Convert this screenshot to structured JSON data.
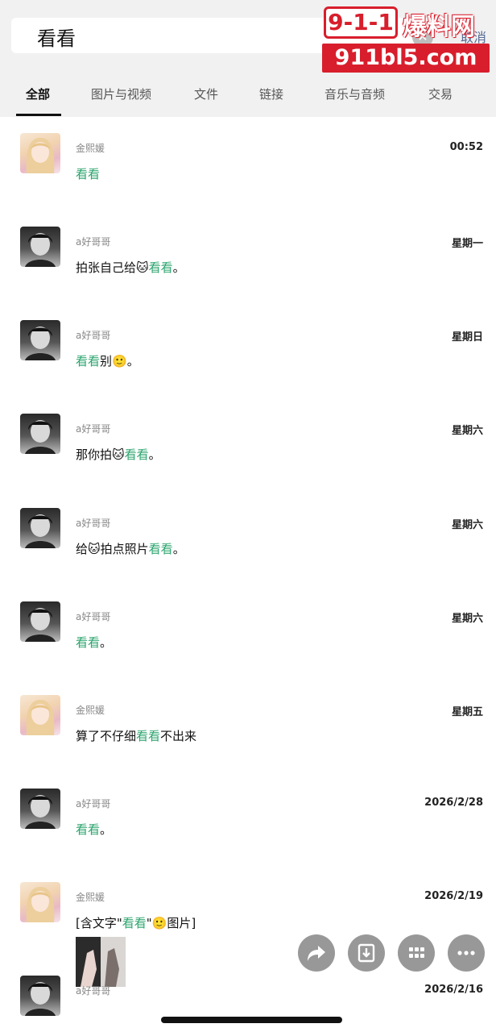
{
  "search": {
    "query": "看看",
    "cancel_label": "取消"
  },
  "tabs": [
    "全部",
    "图片与视频",
    "文件",
    "链接",
    "音乐与音频",
    "交易"
  ],
  "results": [
    {
      "sender": "金熙媛",
      "time": "00:52",
      "avatar": "girl",
      "parts": [
        {
          "t": "看看",
          "hl": true
        }
      ]
    },
    {
      "sender": "a好哥哥",
      "time": "星期一",
      "avatar": "boy",
      "parts": [
        {
          "t": "拍张自己给"
        },
        {
          "t": "🐱",
          "emoji": true
        },
        {
          "t": "看看",
          "hl": true
        },
        {
          "t": "。"
        }
      ]
    },
    {
      "sender": "a好哥哥",
      "time": "星期日",
      "avatar": "boy",
      "parts": [
        {
          "t": "看看",
          "hl": true
        },
        {
          "t": "别"
        },
        {
          "t": "🙂",
          "emoji": true
        },
        {
          "t": "。"
        }
      ]
    },
    {
      "sender": "a好哥哥",
      "time": "星期六",
      "avatar": "boy",
      "parts": [
        {
          "t": "那你拍"
        },
        {
          "t": "🐱",
          "emoji": true
        },
        {
          "t": "看看",
          "hl": true
        },
        {
          "t": "。"
        }
      ]
    },
    {
      "sender": "a好哥哥",
      "time": "星期六",
      "avatar": "boy",
      "parts": [
        {
          "t": "给"
        },
        {
          "t": "🐱",
          "emoji": true
        },
        {
          "t": "拍点照片"
        },
        {
          "t": "看看",
          "hl": true
        },
        {
          "t": "。"
        }
      ]
    },
    {
      "sender": "a好哥哥",
      "time": "星期六",
      "avatar": "boy",
      "parts": [
        {
          "t": "看看",
          "hl": true
        },
        {
          "t": "。"
        }
      ]
    },
    {
      "sender": "金熙媛",
      "time": "星期五",
      "avatar": "girl",
      "parts": [
        {
          "t": "算了不仔细"
        },
        {
          "t": "看看",
          "hl": true
        },
        {
          "t": "不出来"
        }
      ]
    },
    {
      "sender": "a好哥哥",
      "time": "2026/2/28",
      "avatar": "boy",
      "parts": [
        {
          "t": "看看",
          "hl": true
        },
        {
          "t": "。"
        }
      ]
    },
    {
      "sender": "金熙媛",
      "time": "2026/2/19",
      "avatar": "girl",
      "has_image": true,
      "parts": [
        {
          "t": "[含文字\""
        },
        {
          "t": "看看",
          "hl": true
        },
        {
          "t": "\""
        },
        {
          "t": "🙂",
          "emoji": true
        },
        {
          "t": "图片]"
        }
      ]
    },
    {
      "sender": "a好哥哥",
      "time": "2026/2/16",
      "avatar": "boy",
      "parts": []
    }
  ],
  "watermark": {
    "tag": "9-1-1",
    "name": "爆料网",
    "url": "911bl5.com"
  },
  "actions": [
    "share-icon",
    "save-icon",
    "grid-icon",
    "more-icon"
  ]
}
